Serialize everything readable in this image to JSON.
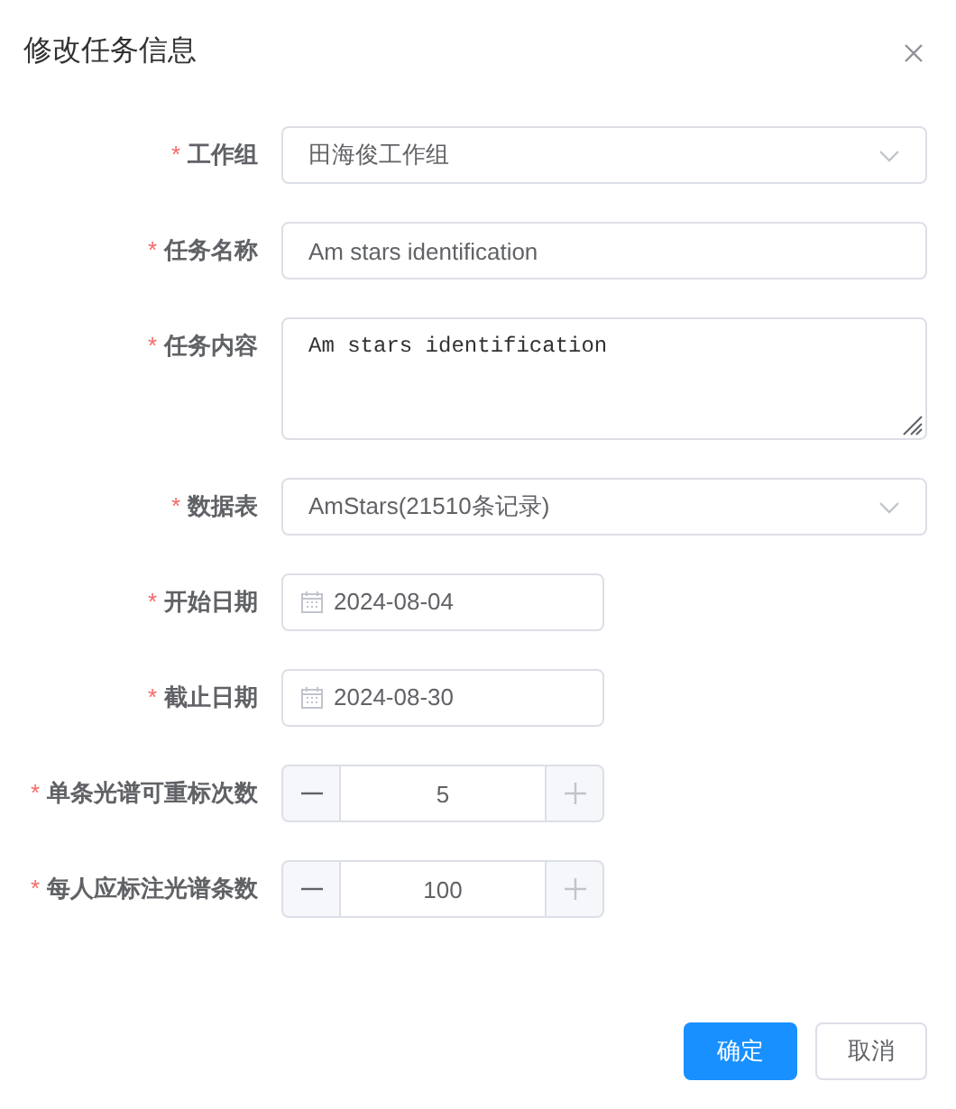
{
  "dialog": {
    "title": "修改任务信息"
  },
  "fields": [
    {
      "kind": "select",
      "required_mark": "*",
      "label": "工作组",
      "value": "田海俊工作组"
    },
    {
      "kind": "text",
      "required_mark": "*",
      "label": "任务名称",
      "value": "Am stars identification"
    },
    {
      "kind": "textarea",
      "required_mark": "*",
      "label": "任务内容",
      "value": "Am stars identification"
    },
    {
      "kind": "select",
      "required_mark": "*",
      "label": "数据表",
      "value": "AmStars(21510条记录)"
    },
    {
      "kind": "date",
      "required_mark": "*",
      "label": "开始日期",
      "value": "2024-08-04"
    },
    {
      "kind": "date",
      "required_mark": "*",
      "label": "截止日期",
      "value": "2024-08-30"
    },
    {
      "kind": "number",
      "required_mark": "*",
      "label": "单条光谱可重标次数",
      "value": "5",
      "plus_disabled": true
    },
    {
      "kind": "number",
      "required_mark": "*",
      "label": "每人应标注光谱条数",
      "value": "100",
      "plus_disabled": true
    }
  ],
  "buttons": [
    {
      "label": "确定",
      "primary": true
    },
    {
      "label": "取消",
      "primary": false
    }
  ]
}
